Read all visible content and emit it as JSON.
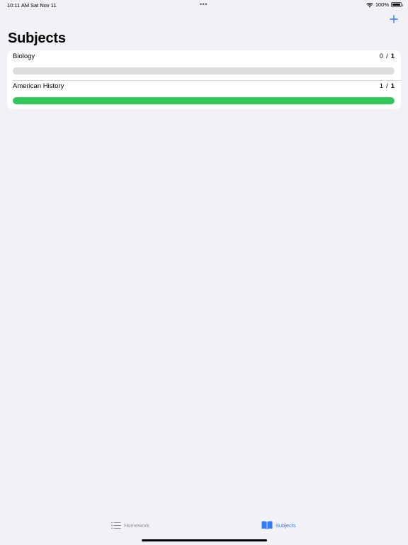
{
  "status_bar": {
    "time": "10:11 AM",
    "date": "Sat Nov 11",
    "multitask": "•••",
    "battery": "100%",
    "icons": [
      "wifi-icon",
      "battery-icon"
    ]
  },
  "nav": {
    "title": "Subjects",
    "add_icon": "plus-icon"
  },
  "subjects": [
    {
      "name": "Biology",
      "done": "0",
      "sep": "/",
      "total": "1",
      "progress": 0.0
    },
    {
      "name": "American History",
      "done": "1",
      "sep": "/",
      "total": "1",
      "progress": 1.0
    }
  ],
  "tab_bar": {
    "tabs": [
      {
        "label": "Homework",
        "icon": "list-icon",
        "selected": false
      },
      {
        "label": "Subjects",
        "icon": "book-icon",
        "selected": true
      }
    ]
  },
  "colors": {
    "accent": "#2f7cf6",
    "progress": "#33c759",
    "track": "#dcdcdc",
    "background": "#f2f1f6"
  }
}
